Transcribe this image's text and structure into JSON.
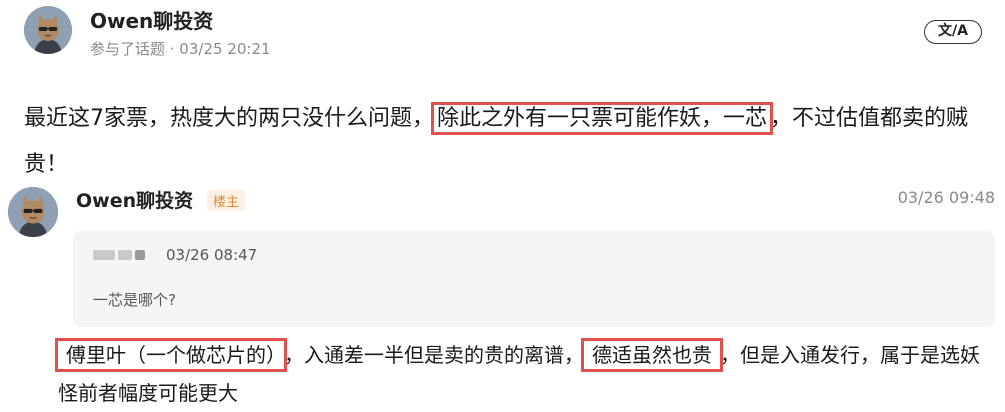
{
  "post": {
    "author": "Owen聊投资",
    "meta": "参与了话题 · 03/25 20:21",
    "translate_label": "文/A",
    "body_part1": "最近这7家票，热度大的两只没什么问题，",
    "body_highlight": "除此之外有一只票可能作妖，一芯",
    "body_part2": "，不过估值都卖的贼贵！"
  },
  "reply": {
    "author": "Owen聊投资",
    "badge": "楼主",
    "time": "03/26 09:48",
    "quote": {
      "time": "03/26 08:47",
      "text": "一芯是哪个?"
    },
    "highlight1": "傅里叶（一个做芯片的）",
    "text_mid": "，入通差一半但是卖的贵的离谱，",
    "highlight2": "德适虽然也贵",
    "text_end": "，但是入通发行，属于是选妖怪前者幅度可能更大"
  },
  "colors": {
    "highlight_border": "#e0504d",
    "badge_text": "#e08a3a",
    "quote_bg": "#f4f5f7"
  }
}
